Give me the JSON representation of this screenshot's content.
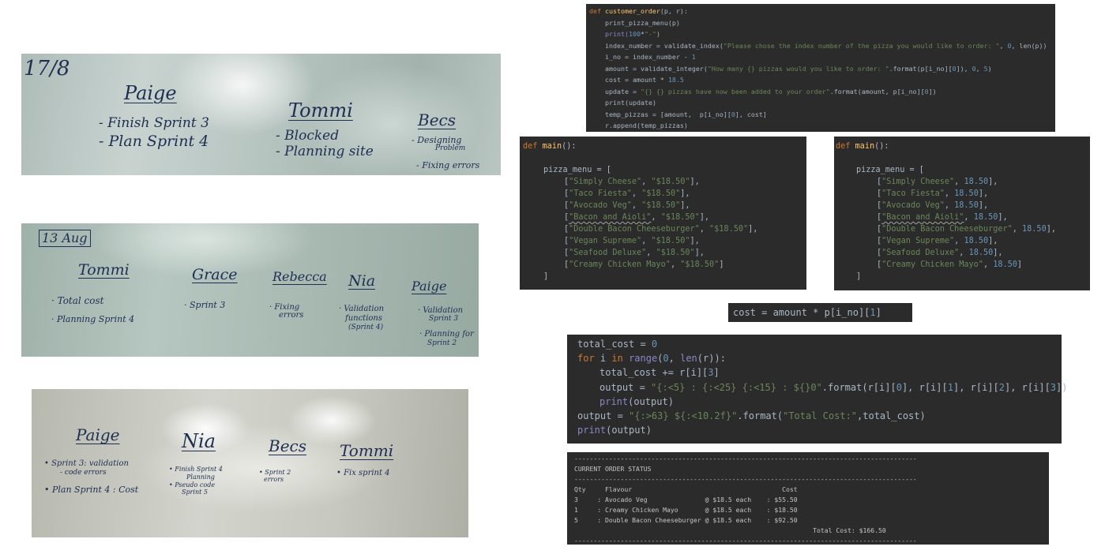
{
  "whiteboards": {
    "board1": {
      "date": "17/8",
      "col1": {
        "name": "Paige",
        "items": [
          "- Finish Sprint 3",
          "- Plan Sprint 4"
        ]
      },
      "col2": {
        "name": "Tommi",
        "items": [
          "- Blocked",
          "- Planning site"
        ]
      },
      "col3": {
        "name": "Becs",
        "items": [
          "- Designing",
          "Problem",
          "- Fixing errors"
        ]
      }
    },
    "board2": {
      "date": "13 Aug",
      "col1": {
        "name": "Tommi",
        "items": [
          "· Total cost",
          "· Planning Sprint 4"
        ]
      },
      "col2": {
        "name": "Grace",
        "items": [
          "· Sprint 3"
        ]
      },
      "col3": {
        "name": "Rebecca",
        "items": [
          "· Fixing",
          "errors"
        ]
      },
      "col4": {
        "name": "Nia",
        "items": [
          "· Validation",
          "functions",
          "(Sprint 4)"
        ]
      },
      "col5": {
        "name": "Paige",
        "items": [
          "· Validation",
          "Sprint 3",
          "· Planning for",
          "Sprint 2"
        ]
      }
    },
    "board3": {
      "col1": {
        "name": "Paige",
        "items": [
          "• Sprint 3: validation",
          "- code errors",
          "• Plan Sprint 4 : Cost"
        ]
      },
      "col2": {
        "name": "Nia",
        "items": [
          "• Finish Sprint 4",
          "Planning",
          "• Pseudo code",
          "Sprint 5"
        ]
      },
      "col3": {
        "name": "Becs",
        "items": [
          "• Sprint 2",
          "errors"
        ]
      },
      "col4": {
        "name": "Tommi",
        "items": [
          "• Fix sprint 4"
        ]
      }
    }
  },
  "code_order": {
    "l1_def": "def ",
    "l1_fn": "customer_order",
    "l1_rest": "(p, r):",
    "l2": "print_pizza_menu(p)",
    "l3_a": "print(",
    "l3_num": "100",
    "l3_op": "*",
    "l3_str": "\"-\"",
    "l3_b": ")",
    "l4_a": "index_number = validate_index(",
    "l4_str": "\"Please chose the index number of the pizza you would like to order: \"",
    "l4_b": ", ",
    "l4_num": "0",
    "l4_c": ", len(p))",
    "l5_a": "i_no = index_number - ",
    "l5_num": "1",
    "l6_a": "amount = validate_integer(",
    "l6_str": "\"How many {} pizzas would you like to order: \"",
    "l6_b": ".format(p[i_no][",
    "l6_n1": "0",
    "l6_c": "]), ",
    "l6_n2": "0",
    "l6_d": ", ",
    "l6_n3": "5",
    "l6_e": ")",
    "l7_a": "cost = amount * ",
    "l7_num": "18.5",
    "l8_a": "update = ",
    "l8_str": "\"{} {} pizzas have now been added to your order\"",
    "l8_b": ".format(amount, p[i_no][",
    "l8_num": "0",
    "l8_c": "])",
    "l9": "print(update)",
    "l10_a": "temp_pizzas = [amount,  p[i_no][",
    "l10_num": "0",
    "l10_b": "], cost]",
    "l11": "r.append(temp_pizzas)"
  },
  "code_main_str": {
    "def": "def ",
    "fn": "main",
    "sig": "():",
    "assign": "pizza_menu = [",
    "items": [
      {
        "name": "\"Simply Cheese\"",
        "price": "\"$18.50\""
      },
      {
        "name": "\"Taco Fiesta\"",
        "price": "\"$18.50\""
      },
      {
        "name": "\"Avocado Veg\"",
        "price": "\"$18.50\""
      },
      {
        "name": "\"Bacon and Aioli\"",
        "price": "\"$18.50\""
      },
      {
        "name": "\"Double Bacon Cheeseburger\"",
        "price": "\"$18.50\""
      },
      {
        "name": "\"Vegan Supreme\"",
        "price": "\"$18.50\""
      },
      {
        "name": "\"Seafood Deluxe\"",
        "price": "\"$18.50\""
      },
      {
        "name": "\"Creamy Chicken Mayo\"",
        "price": "\"$18.50\""
      }
    ],
    "close": "]"
  },
  "code_main_num": {
    "def": "def ",
    "fn": "main",
    "sig": "():",
    "assign": "pizza_menu = [",
    "items": [
      {
        "name": "\"Simply Cheese\"",
        "price": "18.50"
      },
      {
        "name": "\"Taco Fiesta\"",
        "price": "18.50"
      },
      {
        "name": "\"Avocado Veg\"",
        "price": "18.50"
      },
      {
        "name": "\"Bacon and Aioli\"",
        "price": "18.50"
      },
      {
        "name": "\"Double Bacon Cheeseburger\"",
        "price": "18.50"
      },
      {
        "name": "\"Vegan Supreme\"",
        "price": "18.50"
      },
      {
        "name": "\"Seafood Deluxe\"",
        "price": "18.50"
      },
      {
        "name": "\"Creamy Chicken Mayo\"",
        "price": "18.50"
      }
    ],
    "close": "]"
  },
  "code_cost": {
    "a": "cost = amount * p[i_no][",
    "num": "1",
    "b": "]"
  },
  "code_total": {
    "l1_a": "total_cost = ",
    "l1_num": "0",
    "l2_for": "for",
    "l2_a": " i ",
    "l2_in": "in",
    "l2_sp": " ",
    "l2_range": "range",
    "l2_b": "(",
    "l2_num": "0",
    "l2_c": ", ",
    "l2_len": "len",
    "l2_d": "(r)):",
    "l3_a": "total_cost += r[i][",
    "l3_num": "3",
    "l3_b": "]",
    "l4_a": "output = ",
    "l4_str": "\"{:<5} : {:<25} {:<15} : ${}0\"",
    "l4_b": ".format(r[i][",
    "l4_n0": "0",
    "l4_c": "], r[i][",
    "l4_n1": "1",
    "l4_d": "], r[i][",
    "l4_n2": "2",
    "l4_e": "], r[i][",
    "l4_n3": "3",
    "l4_f": "])",
    "l5_print": "print",
    "l5_a": "(output)",
    "l6_a": "output = ",
    "l6_str": "\"{:>63} ${:<10.2f}\"",
    "l6_b": ".format(",
    "l6_str2": "\"Total Cost:\"",
    "l6_c": ",total_cost)",
    "l7_print": "print",
    "l7_a": "(output)"
  },
  "order_output": {
    "divider": "-----------------------------------------------------------------------------------------",
    "heading": "CURRENT ORDER STATUS",
    "header": "Qty     Flavour                                       Cost",
    "rows": [
      "3     : Avocado Veg               @ $18.5 each    : $55.50",
      "1     : Creamy Chicken Mayo       @ $18.5 each    : $18.50",
      "5     : Double Bacon Cheeseburger @ $18.5 each    : $92.50"
    ],
    "total": "                                                              Total Cost: $166.50"
  }
}
